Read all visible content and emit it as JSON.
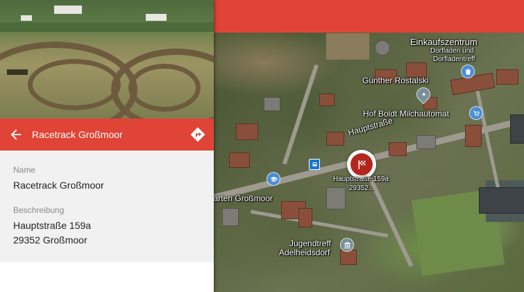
{
  "panel": {
    "title": "Racetrack Großmoor",
    "back_icon": "arrow-left-icon",
    "directions_icon": "directions-icon",
    "name_label": "Name",
    "name_value": "Racetrack Großmoor",
    "description_label": "Beschreibung",
    "description_line1": "Hauptstraße 159a",
    "description_line2": "29352 Großmoor"
  },
  "map": {
    "street": "Hauptstraße",
    "marker_label_line1": "Hauptstraße 159a",
    "marker_label_line2": "29352...",
    "marker_icon": "checkered-flag-icon",
    "pois": [
      {
        "name": "Einkaufszentrum",
        "sub1": "Dorfladen und",
        "sub2": "Dorfladentreff",
        "icon": "shopping-bag-icon"
      },
      {
        "name": "Günther Rostalski",
        "icon": "location-pin-icon"
      },
      {
        "name": "Hof Boldt Milchautomat",
        "icon": "shopping-cart-icon"
      },
      {
        "name": "rgarten Großmoor",
        "icon": "graduation-cap-icon"
      },
      {
        "name": "Jugendtreff",
        "sub1": "Adelheidsdorf",
        "icon": "museum-icon"
      }
    ],
    "colors": {
      "accent": "#e04436",
      "marker": "#b3261e",
      "poi_blue": "#4a8fd6"
    }
  }
}
